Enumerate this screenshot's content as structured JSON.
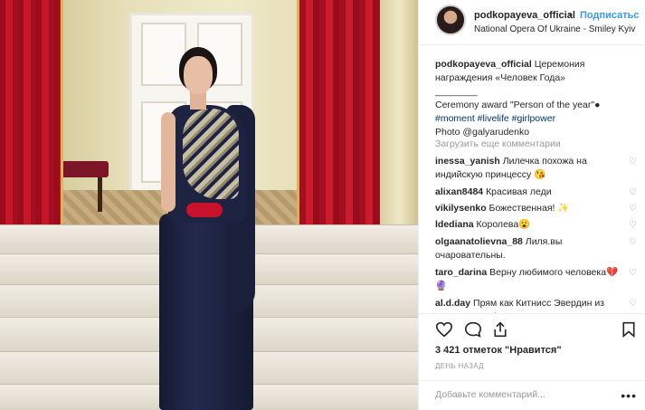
{
  "post": {
    "username": "podkopayeva_official",
    "separator": "•",
    "follow_label": "Подписатьс",
    "location": "National Opera Of Ukraine - Smiley Kyiv"
  },
  "caption": {
    "username": "podkopayeva_official",
    "line1": "Церемония награждения «Человек Года»",
    "divider": "________",
    "line2": "Ceremony award \"Person of the year\"●",
    "tags": "#moment #livelife #girlpower",
    "photo_credit": "Photo @galyarudenko"
  },
  "load_more_label": "Загрузить еще комментарии",
  "comments": [
    {
      "username": "inessa_yanish",
      "text": "Лилечка похожа на индийскую принцессу 😘"
    },
    {
      "username": "alixan8484",
      "text": "Красивая леди"
    },
    {
      "username": "vikilysenko",
      "text": "Божественная! ✨"
    },
    {
      "username": "ldediana",
      "text": "Королева😮"
    },
    {
      "username": "olgaanatolievna_88",
      "text": "Лиля.вы очаровательны."
    },
    {
      "username": "taro_darina",
      "text": "Верну любимого человека💔🔮"
    },
    {
      "username": "al.d.day",
      "text": "Прям как Китнисс Эвердин из Голодных игр)"
    }
  ],
  "likes_text": "3 421 отметок \"Нравится\"",
  "timestamp": "ДЕНЬ НАЗАД",
  "add_comment_placeholder": "Добавьте комментарий...",
  "more_options_label": "•••",
  "icons": {
    "like": "heart-icon",
    "comment": "comment-icon",
    "share": "share-icon",
    "save": "bookmark-icon",
    "comment_like": "heart-icon"
  }
}
